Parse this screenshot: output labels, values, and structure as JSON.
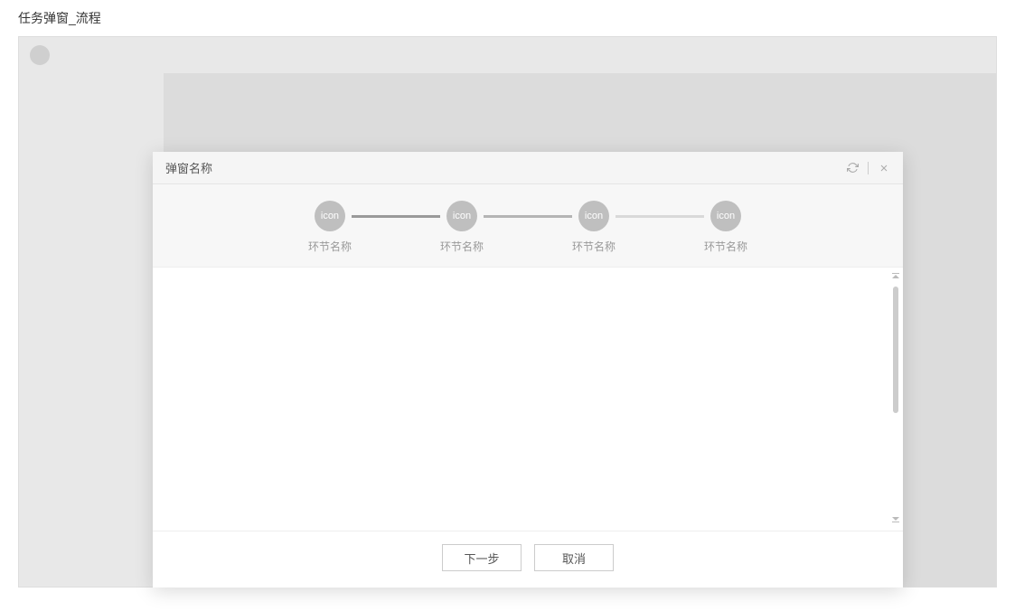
{
  "page": {
    "title": "任务弹窗_流程"
  },
  "modal": {
    "title": "弹窗名称",
    "steps": [
      {
        "icon_label": "icon",
        "name": "环节名称"
      },
      {
        "icon_label": "icon",
        "name": "环节名称"
      },
      {
        "icon_label": "icon",
        "name": "环节名称"
      },
      {
        "icon_label": "icon",
        "name": "环节名称"
      }
    ],
    "footer": {
      "next_label": "下一步",
      "cancel_label": "取消"
    }
  }
}
